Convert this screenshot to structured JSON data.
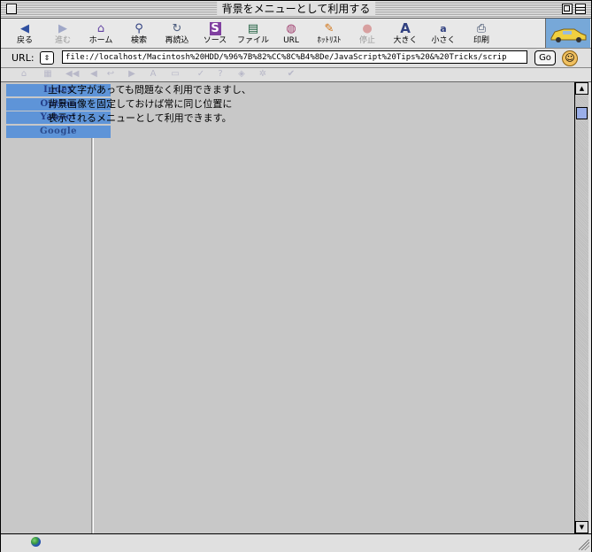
{
  "window": {
    "title": "背景をメニューとして利用する"
  },
  "toolbar": {
    "buttons": [
      {
        "label": "戻る",
        "icon": "back-arrow-icon",
        "enabled": true
      },
      {
        "label": "進む",
        "icon": "forward-arrow-icon",
        "enabled": false
      },
      {
        "label": "ホーム",
        "icon": "home-icon",
        "enabled": true
      },
      {
        "label": "検索",
        "icon": "search-icon",
        "enabled": true
      },
      {
        "label": "再読込",
        "icon": "reload-icon",
        "enabled": true
      },
      {
        "label": "ソース",
        "icon": "source-icon",
        "enabled": true
      },
      {
        "label": "ファイル",
        "icon": "file-icon",
        "enabled": true
      },
      {
        "label": "URL",
        "icon": "url-icon",
        "enabled": true
      },
      {
        "label": "ﾎｯﾄﾘｽﾄ",
        "icon": "hotlist-icon",
        "enabled": true
      },
      {
        "label": "停止",
        "icon": "stop-icon",
        "enabled": false
      },
      {
        "label": "大きく",
        "icon": "font-larger-icon",
        "enabled": true
      },
      {
        "label": "小さく",
        "icon": "font-smaller-icon",
        "enabled": true
      },
      {
        "label": "印刷",
        "icon": "print-icon",
        "enabled": true
      }
    ]
  },
  "urlbar": {
    "label": "URL:",
    "value": "file://localhost/Macintosh%20HDD/%96%7B%82%CC%8C%B4%8De/JavaScript%20Tips%20&%20Tricks/scrip",
    "go_label": "Go"
  },
  "content": {
    "menu_items": [
      "Index",
      "Option",
      "Yahoo!",
      "Google"
    ],
    "body_lines": [
      "上に文字があっても問題なく利用できますし、",
      "背景画像を固定しておけば常に同じ位置に",
      "表示されるメニューとして利用できます。"
    ]
  },
  "colors": {
    "menu_bg": "#5e94d8",
    "menu_text": "#243e88",
    "page_bg": "#c8c8c8"
  }
}
